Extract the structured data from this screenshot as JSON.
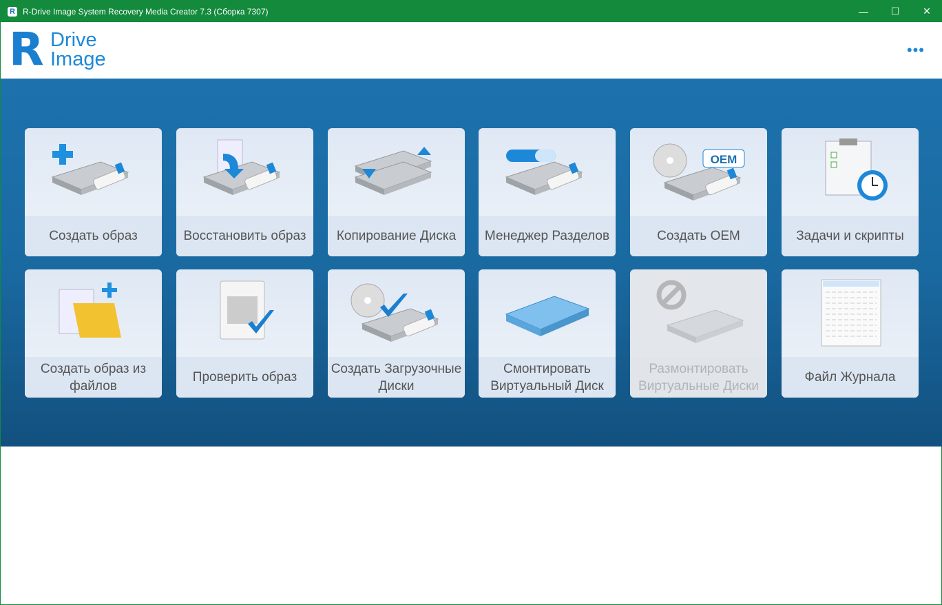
{
  "window": {
    "title": "R-Drive Image System Recovery Media Creator 7.3 (Сборка 7307)",
    "minimize": "—",
    "maximize": "☐",
    "close": "✕"
  },
  "header": {
    "logo_letter": "R",
    "logo_line1": "Drive",
    "logo_line2": "Image",
    "more": "•••"
  },
  "colors": {
    "titlebar": "#138a3c",
    "accent": "#1e88d8",
    "band": "#1a6aa2"
  },
  "tiles": [
    {
      "label": "Создать образ",
      "icon": "disk-plus-icon",
      "enabled": true
    },
    {
      "label": "Восстановить образ",
      "icon": "disk-restore-icon",
      "enabled": true
    },
    {
      "label": "Копирование Диска",
      "icon": "disk-copy-icon",
      "enabled": true
    },
    {
      "label": "Менеджер Разделов",
      "icon": "partition-manager-icon",
      "enabled": true
    },
    {
      "label": "Создать OEM",
      "icon": "oem-icon",
      "enabled": true
    },
    {
      "label": "Задачи и скрипты",
      "icon": "tasks-clock-icon",
      "enabled": true
    },
    {
      "label": "Создать образ из файлов",
      "icon": "folder-plus-icon",
      "enabled": true
    },
    {
      "label": "Проверить образ",
      "icon": "check-image-icon",
      "enabled": true
    },
    {
      "label": "Создать Загрузочные Диски",
      "icon": "boot-disk-icon",
      "enabled": true
    },
    {
      "label": "Смонтировать Виртуальный Диск",
      "icon": "mount-disk-icon",
      "enabled": true
    },
    {
      "label": "Размонтировать Виртуальные Диски",
      "icon": "unmount-disk-icon",
      "enabled": false
    },
    {
      "label": "Файл Журнала",
      "icon": "log-file-icon",
      "enabled": true
    }
  ],
  "oem_badge": "OEM"
}
